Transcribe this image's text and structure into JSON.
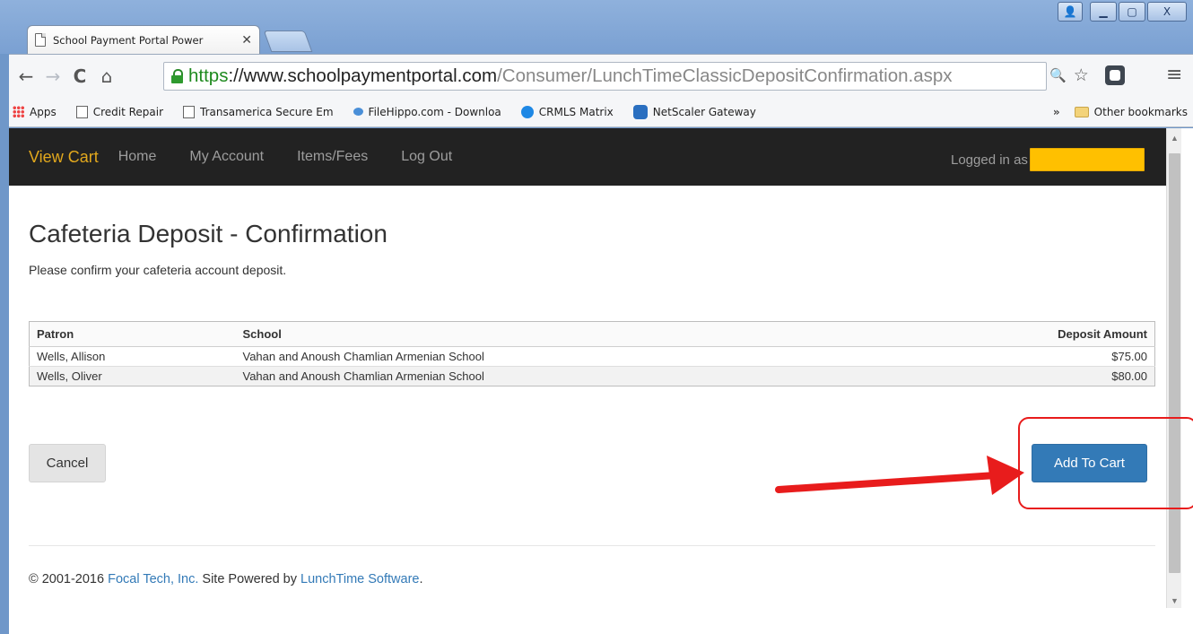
{
  "browser": {
    "tab_title": "School Payment Portal Power",
    "tab_close": "✕",
    "window_controls": {
      "user": "👤",
      "minimize": "▁",
      "maximize": "▢",
      "close": "X"
    },
    "nav": {
      "back": "←",
      "forward": "→",
      "reload": "C",
      "home": "⌂"
    },
    "url_scheme": "https",
    "url_host": "://www.schoolpaymentportal.com",
    "url_path": "/Consumer/LunchTimeClassicDepositConfirmation.aspx",
    "omnibox_icons": {
      "zoom": "🔍",
      "star": "☆"
    },
    "menu": "≡",
    "bookmarks": [
      {
        "label": "Apps",
        "icon": "apps-grid-icon"
      },
      {
        "label": "Credit Repair",
        "icon": "page-icon"
      },
      {
        "label": "Transamerica Secure Em",
        "icon": "page-icon"
      },
      {
        "label": "FileHippo.com - Downloa",
        "icon": "filehippo-icon"
      },
      {
        "label": "CRMLS Matrix",
        "icon": "crmls-icon"
      },
      {
        "label": "NetScaler Gateway",
        "icon": "netscaler-icon"
      }
    ],
    "bookmarks_overflow": "»",
    "other_bookmarks": "Other bookmarks"
  },
  "site_nav": {
    "brand": "View Cart",
    "links": [
      "Home",
      "My Account",
      "Items/Fees",
      "Log Out"
    ],
    "logged_in_label": "Logged in as"
  },
  "page": {
    "title": "Cafeteria Deposit - Confirmation",
    "subtitle": "Please confirm your cafeteria account deposit."
  },
  "table": {
    "headers": [
      "Patron",
      "School",
      "Deposit Amount"
    ],
    "rows": [
      {
        "patron": "Wells, Allison",
        "school": "Vahan and Anoush Chamlian Armenian School",
        "amount": "$75.00"
      },
      {
        "patron": "Wells, Oliver",
        "school": "Vahan and Anoush Chamlian Armenian School",
        "amount": "$80.00"
      }
    ]
  },
  "buttons": {
    "cancel": "Cancel",
    "add_to_cart": "Add To Cart"
  },
  "annotation": {
    "color": "#e81c1c"
  },
  "footer": {
    "prefix": "© 2001-2016 ",
    "company": "Focal Tech, Inc.",
    "middle": " Site Powered by ",
    "software": "LunchTime Software",
    "suffix": "."
  },
  "colors": {
    "navbar": "#222222",
    "brand": "#e2a81d",
    "primary_button": "#337ab7",
    "redaction": "#ffc000"
  }
}
